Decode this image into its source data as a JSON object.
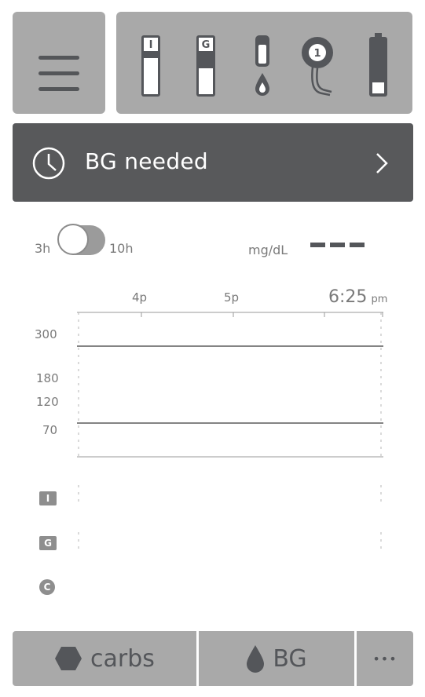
{
  "banner": {
    "text": "BG needed"
  },
  "status": {
    "insulin_label": "I",
    "glucagon_label": "G",
    "sensor_number": "1"
  },
  "range_toggle": {
    "short_label": "3h",
    "long_label": "10h"
  },
  "unit": {
    "label": "mg/dL",
    "value": "— — —"
  },
  "chart_data": {
    "type": "line",
    "x_ticks": [
      {
        "label": "4p"
      },
      {
        "label": "5p"
      }
    ],
    "current_time": {
      "time": "6:25",
      "suffix": "pm"
    },
    "y_ticks": [
      "300",
      "180",
      "120",
      "70"
    ],
    "target_lines": [
      300,
      70
    ],
    "series": []
  },
  "rows": {
    "insulin": "I",
    "glucagon": "G",
    "carbs": "C"
  },
  "bottom": {
    "carbs_label": "carbs",
    "bg_label": "BG",
    "more_label": "•••"
  },
  "colors": {
    "panel": "#a9a9a9",
    "banner": "#58595b",
    "icon": "#54565a"
  }
}
